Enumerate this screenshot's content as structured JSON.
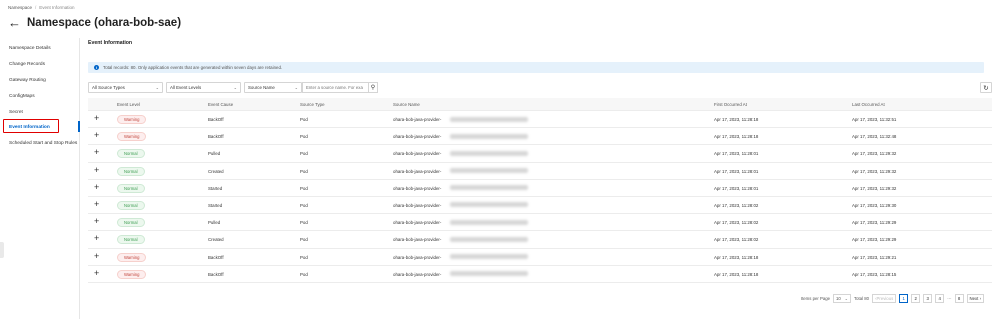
{
  "breadcrumb": {
    "root": "Namespace",
    "current": "Event Information"
  },
  "page": {
    "title": "Namespace (ohara-bob-sae)"
  },
  "sidebar": {
    "items": [
      {
        "label": "Namespace Details"
      },
      {
        "label": "Change Records"
      },
      {
        "label": "Gateway Routing"
      },
      {
        "label": "ConfigMaps"
      },
      {
        "label": "Secret"
      },
      {
        "label": "Event Information",
        "active": true
      },
      {
        "label": "Scheduled Start and Stop Rules"
      }
    ]
  },
  "main": {
    "section_title": "Event Information",
    "notice": "Total records: 80. Only application events that are generated within seven days are retained.",
    "filters": {
      "source_types": "All Source Types",
      "event_levels": "All Event Levels",
      "search_by": "Source Name",
      "search_placeholder": "Enter a source name. For exa"
    },
    "columns": [
      "Event Level",
      "Event Cause",
      "Source Type",
      "Source Name",
      "First Occurred At",
      "Last Occurred At"
    ],
    "rows": [
      {
        "level": "Warning",
        "cause": "BackOff",
        "type": "Pod",
        "name": "ohara-bob-java-provider-",
        "first": "Apr 17, 2023, 11:28:18",
        "last": "Apr 17, 2023, 11:32:51"
      },
      {
        "level": "Warning",
        "cause": "BackOff",
        "type": "Pod",
        "name": "ohara-bob-java-provider-",
        "first": "Apr 17, 2023, 11:28:18",
        "last": "Apr 17, 2023, 11:32:48"
      },
      {
        "level": "Normal",
        "cause": "Pulled",
        "type": "Pod",
        "name": "ohara-bob-java-provider-",
        "first": "Apr 17, 2023, 11:28:01",
        "last": "Apr 17, 2023, 11:29:32"
      },
      {
        "level": "Normal",
        "cause": "Created",
        "type": "Pod",
        "name": "ohara-bob-java-provider-",
        "first": "Apr 17, 2023, 11:28:01",
        "last": "Apr 17, 2023, 11:29:32"
      },
      {
        "level": "Normal",
        "cause": "Started",
        "type": "Pod",
        "name": "ohara-bob-java-provider-",
        "first": "Apr 17, 2023, 11:28:01",
        "last": "Apr 17, 2023, 11:29:32"
      },
      {
        "level": "Normal",
        "cause": "Started",
        "type": "Pod",
        "name": "ohara-bob-java-provider-",
        "first": "Apr 17, 2023, 11:28:02",
        "last": "Apr 17, 2023, 11:29:30"
      },
      {
        "level": "Normal",
        "cause": "Pulled",
        "type": "Pod",
        "name": "ohara-bob-java-provider-",
        "first": "Apr 17, 2023, 11:28:02",
        "last": "Apr 17, 2023, 11:29:29"
      },
      {
        "level": "Normal",
        "cause": "Created",
        "type": "Pod",
        "name": "ohara-bob-java-provider-",
        "first": "Apr 17, 2023, 11:28:02",
        "last": "Apr 17, 2023, 11:29:29"
      },
      {
        "level": "Warning",
        "cause": "BackOff",
        "type": "Pod",
        "name": "ohara-bob-java-provider-",
        "first": "Apr 17, 2023, 11:28:18",
        "last": "Apr 17, 2023, 11:29:21"
      },
      {
        "level": "Warning",
        "cause": "BackOff",
        "type": "Pod",
        "name": "ohara-bob-java-provider-",
        "first": "Apr 17, 2023, 11:28:18",
        "last": "Apr 17, 2023, 11:28:15"
      }
    ]
  },
  "pagination": {
    "items_per_page_label": "Items per Page",
    "page_size": "10",
    "total": "Total 80",
    "previous": "Previous",
    "pages": [
      "1",
      "2",
      "3",
      "4"
    ],
    "ellipsis": "···",
    "last_page": "8",
    "next": "Next"
  },
  "colors": {
    "accent": "#0064c8",
    "warning": "#c1453c",
    "normal": "#3a9b4f",
    "highlight_box": "#e00000"
  }
}
